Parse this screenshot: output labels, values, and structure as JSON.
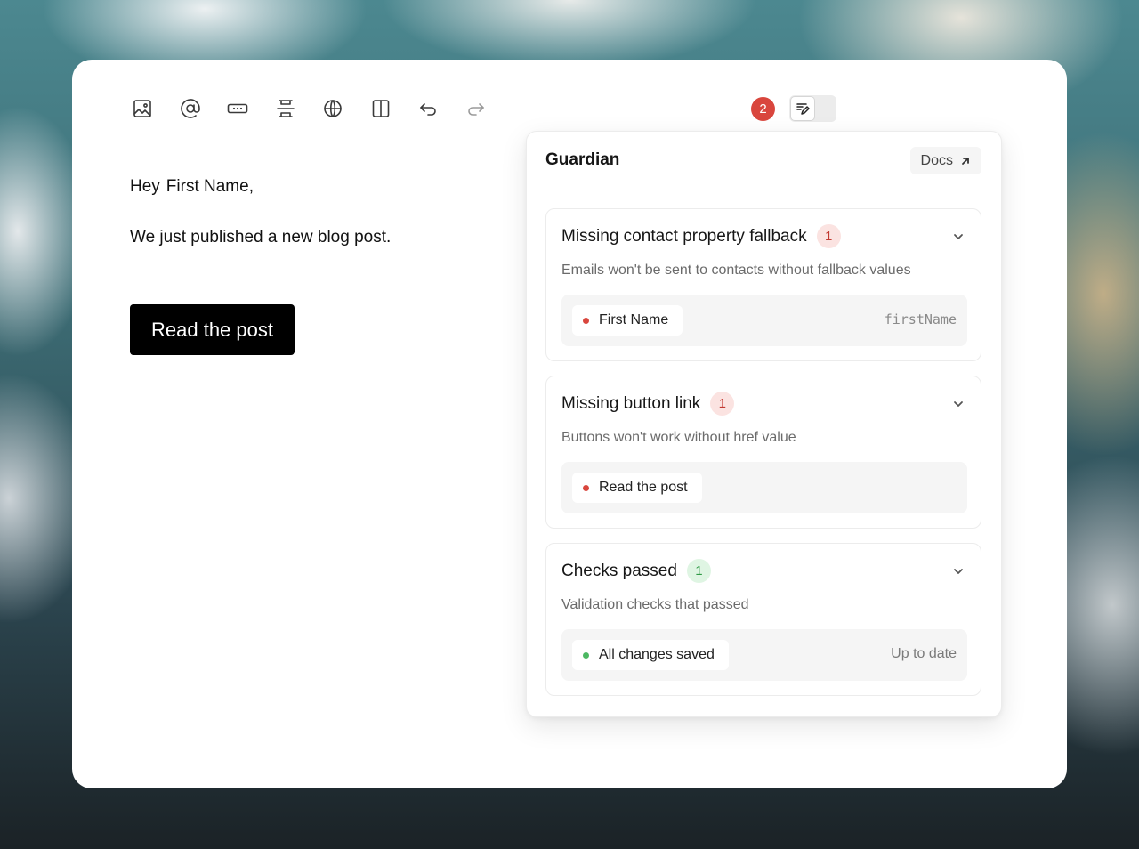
{
  "toolbar": {
    "tools": [
      {
        "name": "image-icon"
      },
      {
        "name": "mention-icon"
      },
      {
        "name": "button-icon"
      },
      {
        "name": "divider-icon"
      },
      {
        "name": "globe-icon"
      },
      {
        "name": "columns-icon"
      },
      {
        "name": "undo-icon"
      },
      {
        "name": "redo-icon"
      }
    ],
    "error_count": "2",
    "panel_toggle_icon": "guardian-panel-icon"
  },
  "editor": {
    "greeting_prefix": "Hey",
    "greeting_variable": "First Name",
    "greeting_suffix": ",",
    "body": "We just published a new blog post.",
    "button_label": "Read the post"
  },
  "guardian": {
    "title": "Guardian",
    "docs_label": "Docs",
    "sections": [
      {
        "title": "Missing contact property fallback",
        "count": "1",
        "status": "error",
        "description": "Emails won't be sent to contacts without fallback values",
        "item_label": "First Name",
        "item_meta": "firstName"
      },
      {
        "title": "Missing button link",
        "count": "1",
        "status": "error",
        "description": "Buttons won't work without href value",
        "item_label": "Read the post",
        "item_meta": ""
      },
      {
        "title": "Checks passed",
        "count": "1",
        "status": "ok",
        "description": "Validation checks that passed",
        "item_label": "All changes saved",
        "item_meta": "Up to date"
      }
    ]
  },
  "colors": {
    "error": "#d9463d",
    "success": "#4cb862",
    "button_bg": "#000000"
  }
}
